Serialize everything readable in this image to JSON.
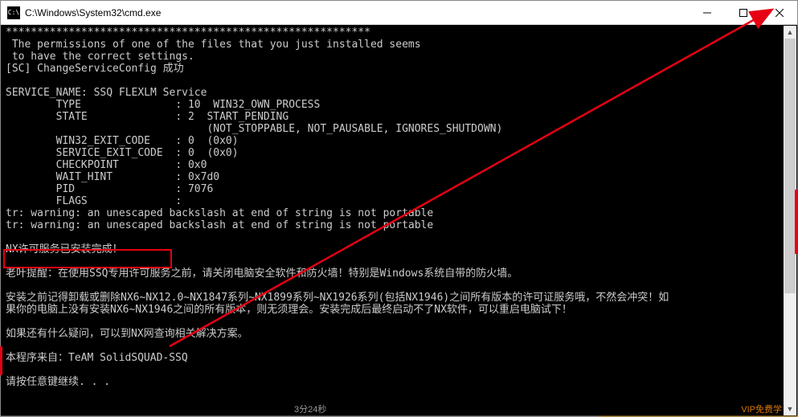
{
  "titlebar": {
    "icon_text": "C:\\",
    "title": "C:\\Windows\\System32\\cmd.exe"
  },
  "terminal": {
    "lines": [
      "**********************************************************",
      " The permissions of one of the files that you just installed seems",
      " to have the correct settings.",
      "[SC] ChangeServiceConfig 成功",
      "",
      "SERVICE_NAME: SSQ FLEXLM Service",
      "        TYPE               : 10  WIN32_OWN_PROCESS",
      "        STATE              : 2  START_PENDING",
      "                                (NOT_STOPPABLE, NOT_PAUSABLE, IGNORES_SHUTDOWN)",
      "        WIN32_EXIT_CODE    : 0  (0x0)",
      "        SERVICE_EXIT_CODE  : 0  (0x0)",
      "        CHECKPOINT         : 0x0",
      "        WAIT_HINT          : 0x7d0",
      "        PID                : 7076",
      "        FLAGS              :",
      "tr: warning: an unescaped backslash at end of string is not portable",
      "tr: warning: an unescaped backslash at end of string is not portable",
      "",
      "NX许可服务已安装完成！",
      "",
      "老叶提醒：在使用SSQ专用许可服务之前，请关闭电脑安全软件和防火墙！特别是Windows系统自带的防火墙。",
      "",
      "安装之前记得卸载或删除NX6~NX12.0~NX1847系列~NX1899系列~NX1926系列(包括NX1946)之间所有版本的许可证服务哦，不然会冲突！如",
      "果你的电脑上没有安装NX6~NX1946之间的所有版本，则无须理会。安装完成后最终启动不了NX软件，可以重启电脑试下！",
      "",
      "如果还有什么疑问，可以到NX网查询相关解决方案。",
      "",
      "本程序来自：TeAM SolidSQUAD-SSQ",
      "",
      "请按任意键继续. . ."
    ],
    "highlighted_line_index": 18,
    "highlighted_text": "NX许可服务已安装完成！"
  },
  "footer": {
    "time_fragment": "3分24秒",
    "vip_fragment": "VIP免费学"
  }
}
